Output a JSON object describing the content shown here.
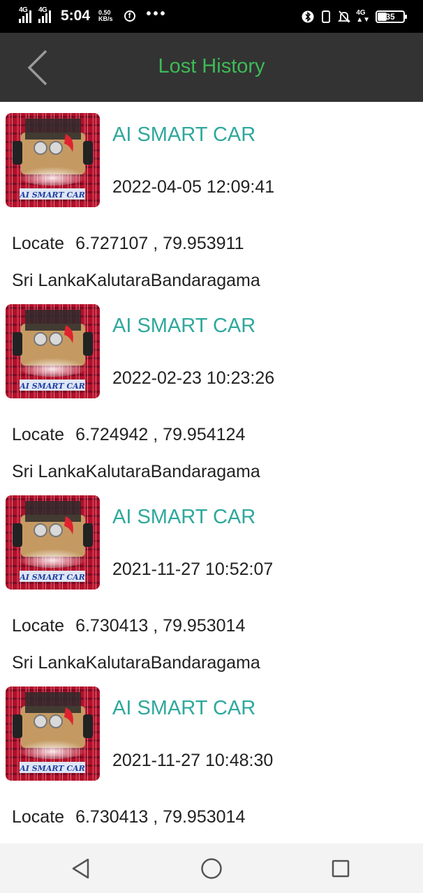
{
  "status_bar": {
    "network_1": "4G",
    "network_2": "4G",
    "time": "5:04",
    "speed_value": "0.50",
    "speed_unit": "KB/s",
    "mobile_data": "4G",
    "battery_level": "35"
  },
  "toolbar": {
    "title": "Lost History"
  },
  "colors": {
    "title_green": "#3dbb56",
    "item_name_teal": "#2fa89c",
    "toolbar_bg": "#333333"
  },
  "records": [
    {
      "name": "AI SMART CAR",
      "datetime": "2022-04-05 12:09:41",
      "locate_label": "Locate",
      "coordinates": "6.727107 , 79.953911",
      "address": "Sri LankaKalutaraBandaragama",
      "thumb_caption": "AI SMART CAR"
    },
    {
      "name": "AI SMART CAR",
      "datetime": "2022-02-23 10:23:26",
      "locate_label": "Locate",
      "coordinates": "6.724942 , 79.954124",
      "address": "Sri LankaKalutaraBandaragama",
      "thumb_caption": "AI SMART CAR"
    },
    {
      "name": "AI SMART CAR",
      "datetime": "2021-11-27 10:52:07",
      "locate_label": "Locate",
      "coordinates": "6.730413 , 79.953014",
      "address": "Sri LankaKalutaraBandaragama",
      "thumb_caption": "AI SMART CAR"
    },
    {
      "name": "AI SMART CAR",
      "datetime": "2021-11-27 10:48:30",
      "locate_label": "Locate",
      "coordinates": "6.730413 , 79.953014",
      "address": "",
      "thumb_caption": "AI SMART CAR"
    }
  ],
  "nav": {
    "back_icon": "triangle-back-icon",
    "home_icon": "circle-home-icon",
    "recents_icon": "square-recents-icon"
  }
}
